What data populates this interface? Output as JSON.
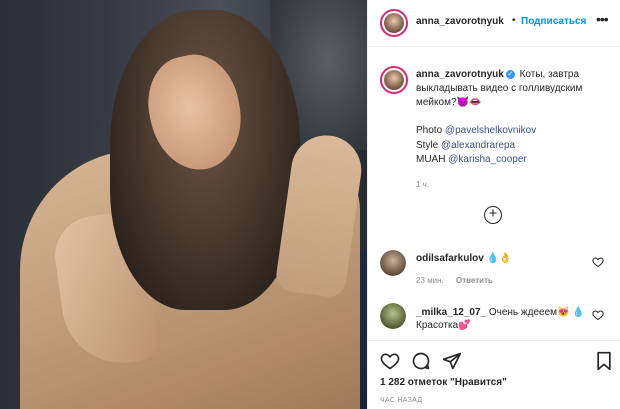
{
  "post": {
    "username": "anna_zavorotnyuk",
    "follow_label": "Подписаться",
    "header_dot": "•",
    "more_label": "•••",
    "caption": {
      "text": "Коты, завтра выкладывать видео с голливудским мейком?😈👄",
      "credits": [
        {
          "prefix": "Photo ",
          "handle": "@pavelshelkovnikov"
        },
        {
          "prefix": "Style ",
          "handle": "@alexandrarepa"
        },
        {
          "prefix": "MUAH ",
          "handle": "@karisha_cooper"
        }
      ],
      "time": "1 ч."
    },
    "load_more_label": "+",
    "comments": [
      {
        "user": "odilsafarkulov",
        "text": "💧👌",
        "time": "23 мин.",
        "reply": "Ответить"
      },
      {
        "user": "_milka_12_07_",
        "text": "Очень ждееем😻 💧Красотка💕",
        "time": "",
        "reply": ""
      }
    ],
    "likes_text": "1 282 отметок \"Нравится\"",
    "timestamp": "ЧАС НАЗАД"
  },
  "icons": {
    "verified": "verified-badge",
    "like": "heart-icon",
    "comment": "comment-icon",
    "share": "share-icon",
    "save": "bookmark-icon"
  },
  "colors": {
    "link": "#385185",
    "follow": "#0095f6",
    "story_ring": "#d62976",
    "verified": "#3897f0",
    "meta": "#8e8e8e"
  }
}
